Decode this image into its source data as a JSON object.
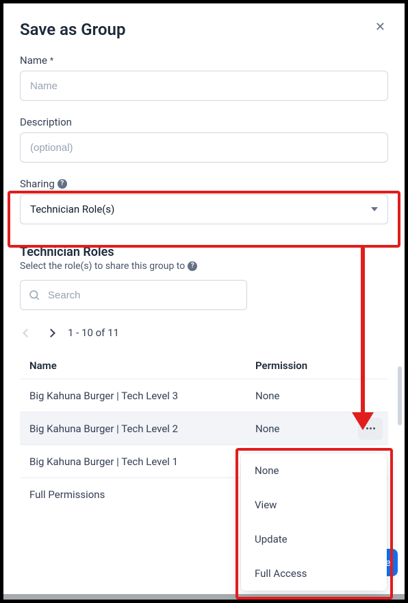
{
  "dialog": {
    "title": "Save as Group",
    "nameLabel": "Name",
    "nameRequiredMark": "*",
    "namePlaceholder": "Name",
    "descLabel": "Description",
    "descPlaceholder": "(optional)",
    "sharingLabel": "Sharing",
    "sharingValue": "Technician Role(s)"
  },
  "roles": {
    "sectionTitle": "Technician Roles",
    "sectionSub": "Select the role(s) to share this group to",
    "searchPlaceholder": "Search",
    "pagerText": "1 - 10 of 11",
    "columns": {
      "name": "Name",
      "perm": "Permission"
    },
    "rows": [
      {
        "name": "Big Kahuna Burger | Tech Level 3",
        "perm": "None"
      },
      {
        "name": "Big Kahuna Burger | Tech Level 2",
        "perm": "None"
      },
      {
        "name": "Big Kahuna Burger | Tech Level 1",
        "perm": ""
      },
      {
        "name": "Full Permissions",
        "perm": ""
      }
    ]
  },
  "menu": {
    "items": [
      "None",
      "View",
      "Update",
      "Full Access"
    ]
  },
  "save": {
    "peek": "e"
  }
}
